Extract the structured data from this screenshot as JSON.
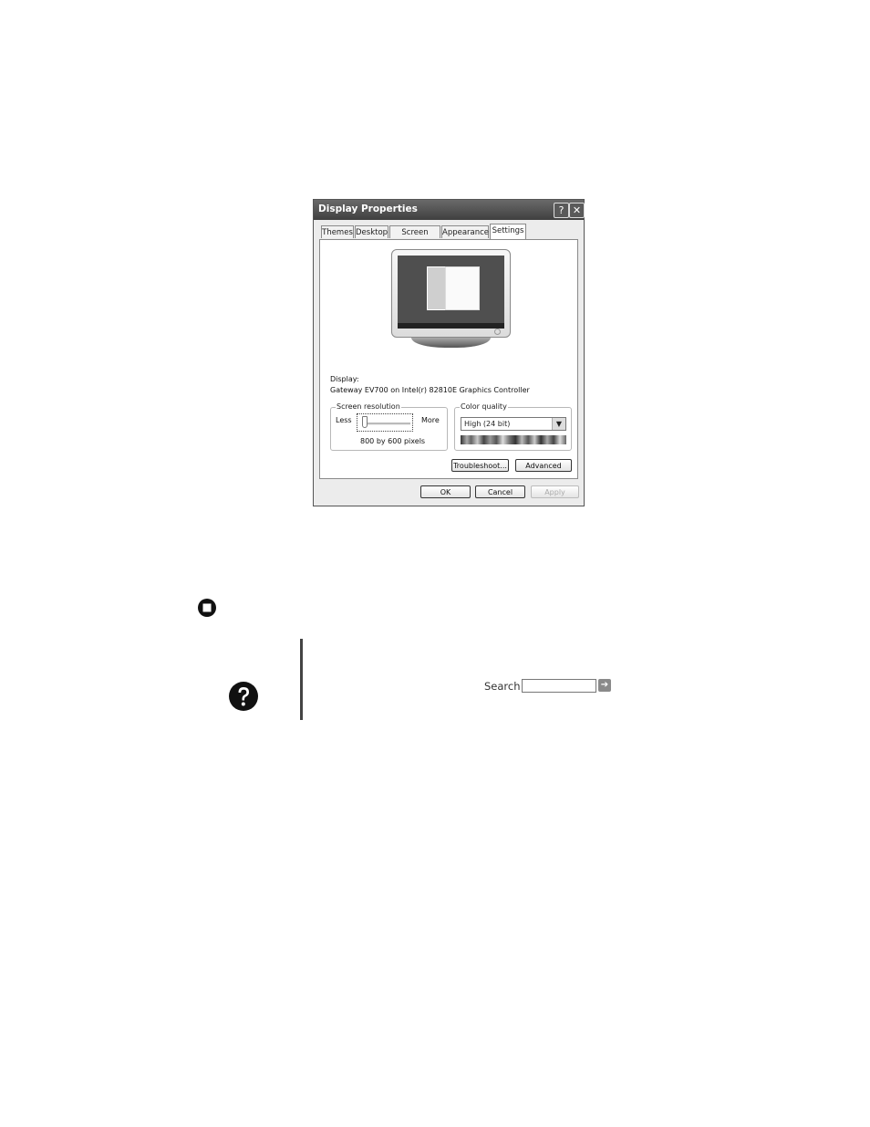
{
  "window": {
    "title": "Display Properties",
    "help_btn": "?",
    "close_btn": "✕"
  },
  "tabs": [
    "Themes",
    "Desktop",
    "Screen Saver",
    "Appearance",
    "Settings"
  ],
  "display": {
    "label": "Display:",
    "device": "Gateway EV700 on Intel(r) 82810E Graphics Controller"
  },
  "resolution": {
    "group_label": "Screen resolution",
    "less": "Less",
    "more": "More",
    "value": "800 by 600 pixels",
    "slider_position": 0
  },
  "color_quality": {
    "group_label": "Color quality",
    "selected": "High (24 bit)"
  },
  "buttons": {
    "troubleshoot": "Troubleshoot...",
    "advanced": "Advanced",
    "ok": "OK",
    "cancel": "Cancel",
    "apply": "Apply"
  },
  "icons": {
    "stop": "stop-icon",
    "help": "help-icon",
    "go": "arrow-right-icon"
  },
  "search": {
    "label": "Search",
    "value": ""
  }
}
